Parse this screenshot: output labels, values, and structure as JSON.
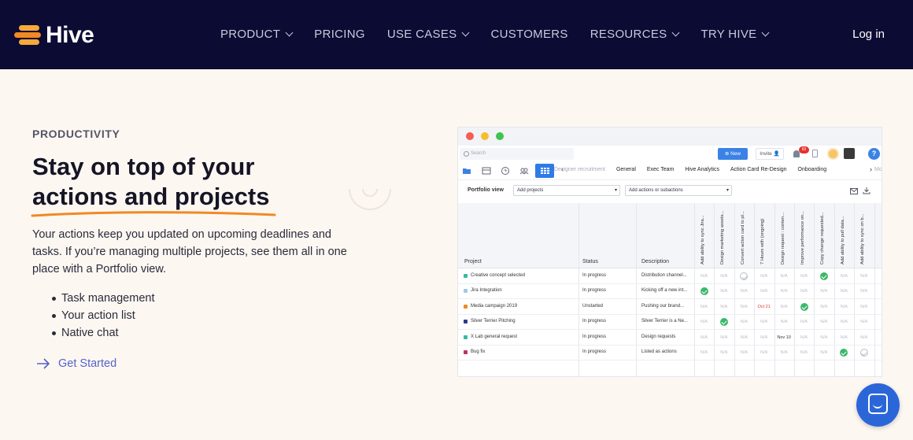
{
  "nav": {
    "logo_text": "Hive",
    "items": [
      {
        "label": "PRODUCT",
        "dropdown": true
      },
      {
        "label": "PRICING",
        "dropdown": false
      },
      {
        "label": "USE CASES",
        "dropdown": true
      },
      {
        "label": "CUSTOMERS",
        "dropdown": false
      },
      {
        "label": "RESOURCES",
        "dropdown": true
      },
      {
        "label": "TRY HIVE",
        "dropdown": true
      }
    ],
    "login": "Log in"
  },
  "hero": {
    "eyebrow": "PRODUCTIVITY",
    "headline_line1": "Stay on top of your",
    "headline_line2": "actions and projects",
    "description": "Your actions keep you updated on upcoming deadlines and tasks. If you’re managing multiple projects, see them all in one place with a Portfolio view.",
    "bullets": [
      "Task management",
      "Your action list",
      "Native chat"
    ],
    "cta": "Get Started",
    "underline_color": "#f08a24"
  },
  "app": {
    "search_placeholder": "Search",
    "new_button": "New",
    "invite_button": "Invite",
    "notification_count": "60",
    "help_label": "?",
    "tabs": [
      "Designer recruitment",
      "General",
      "Exec Team",
      "Hive Analytics",
      "Action Card Re-Design",
      "Onboarding"
    ],
    "tab_overflow": "Mo",
    "portfolio_view_label": "Portfolio view",
    "add_projects": "Add projects",
    "add_actions": "Add actions or subactions",
    "columns": {
      "project": "Project",
      "status": "Status",
      "description": "Description"
    },
    "action_columns": [
      "Add ability to sync Jira...",
      "Design marketing assets...",
      "Convert action card to pl...",
      "7 Hours with (ongoing)",
      "Design request : conten...",
      "Improve performance on...",
      "Copy change requested...",
      "Add ability to pull data...",
      "Add ability to sync on b..."
    ],
    "rows": [
      {
        "project": "Creative concept selected",
        "color": "#3bb8a0",
        "status": "In progress",
        "description": "Distribution channel...",
        "cells": [
          "N/A",
          "N/A",
          "check-outline",
          "N/A",
          "N/A",
          "N/A",
          "check",
          "N/A",
          "N/A"
        ]
      },
      {
        "project": "Jira Integration",
        "color": "#9cc9ee",
        "status": "In progress",
        "description": "Kicking off a new int...",
        "cells": [
          "check",
          "N/A",
          "N/A",
          "N/A",
          "N/A",
          "N/A",
          "N/A",
          "N/A",
          "N/A"
        ]
      },
      {
        "project": "Media campaign 2019",
        "color": "#f08a24",
        "status": "Unstarted",
        "description": "Pushing our brand...",
        "cells": [
          "N/A",
          "N/A",
          "N/A",
          "Oct 21",
          "N/A",
          "check",
          "N/A",
          "N/A",
          "N/A"
        ]
      },
      {
        "project": "Silver Terrier Pitching",
        "color": "#2d3a8c",
        "status": "In progress",
        "description": "Silver Terrier is a Ne...",
        "cells": [
          "N/A",
          "check",
          "N/A",
          "N/A",
          "N/A",
          "N/A",
          "N/A",
          "N/A",
          "N/A"
        ]
      },
      {
        "project": "X Lab general request",
        "color": "#3bb8a0",
        "status": "In progress",
        "description": "Design requests",
        "cells": [
          "N/A",
          "N/A",
          "N/A",
          "N/A",
          "Nov 10",
          "N/A",
          "N/A",
          "N/A",
          "N/A"
        ]
      },
      {
        "project": "Bug fix",
        "color": "#c0306a",
        "status": "In progress",
        "description": "Listed as actions",
        "cells": [
          "N/A",
          "N/A",
          "N/A",
          "N/A",
          "N/A",
          "N/A",
          "N/A",
          "check",
          "check-outline"
        ]
      }
    ]
  }
}
